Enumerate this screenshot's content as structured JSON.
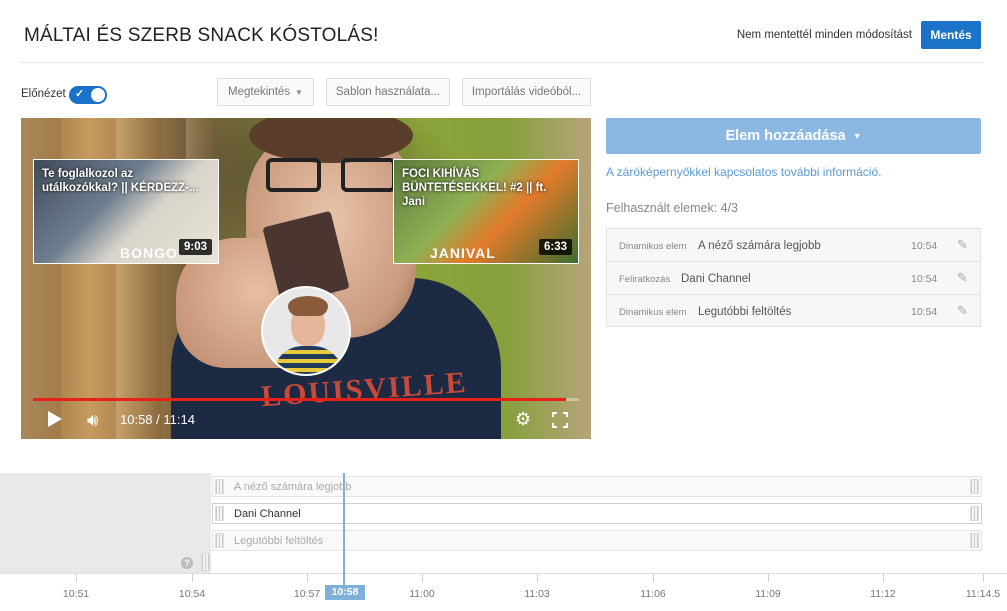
{
  "header": {
    "title": "MÁLTAI ÉS SZERB SNACK KÓSTOLÁS!",
    "unsaved_text": "Nem mentettél minden módosítást",
    "save_label": "Mentés"
  },
  "toolbar": {
    "preview_label": "Előnézet",
    "preview_on": true,
    "view_label": "Megtekintés",
    "template_label": "Sablon használata...",
    "import_label": "Importálás videóból..."
  },
  "video": {
    "current_time": "10:58",
    "total_time": "11:14",
    "time_display": "10:58 / 11:14",
    "progress_fraction": 0.976,
    "cards": [
      {
        "title": "Te foglalkozol az utálkozókkal? || KÉRDEZZ-...",
        "duration": "9:03",
        "brand": "BONGO"
      },
      {
        "title": "FOCI KIHÍVÁS BÜNTETÉSEKKEL! #2 || ft. Jani",
        "duration": "6:33",
        "brand": "JANIVAL"
      }
    ],
    "shirt_text": "LOUISVILLE"
  },
  "panel": {
    "add_label": "Elem hozzáadása",
    "info_link": "A záróképernyőkkel kapcsolatos további információ.",
    "used_text": "Felhasznált elemek: 4/3",
    "elements": [
      {
        "type": "Dinamikus elem",
        "name": "A néző számára legjobb",
        "time": "10:54"
      },
      {
        "type": "Feliratkozás",
        "name": "Dani Channel",
        "time": "10:54"
      },
      {
        "type": "Dinamikus elem",
        "name": "Legutóbbi feltöltés",
        "time": "10:54"
      }
    ]
  },
  "timeline": {
    "tracks": [
      {
        "label": "A néző számára legjobb",
        "active": false
      },
      {
        "label": "Dani Channel",
        "active": true
      },
      {
        "label": "Legutóbbi feltöltés",
        "active": false
      }
    ],
    "help_symbol": "?",
    "ticks": [
      "10:51",
      "10:54",
      "10:57",
      "11:00",
      "11:03",
      "11:06",
      "11:09",
      "11:12",
      "11:14.5"
    ],
    "playhead_label": "10:58"
  },
  "colors": {
    "accent": "#1a73c8",
    "add_button": "#8ab8e3",
    "link": "#5a9bd5",
    "progress": "#e62117",
    "playhead": "#7fb0d9"
  }
}
